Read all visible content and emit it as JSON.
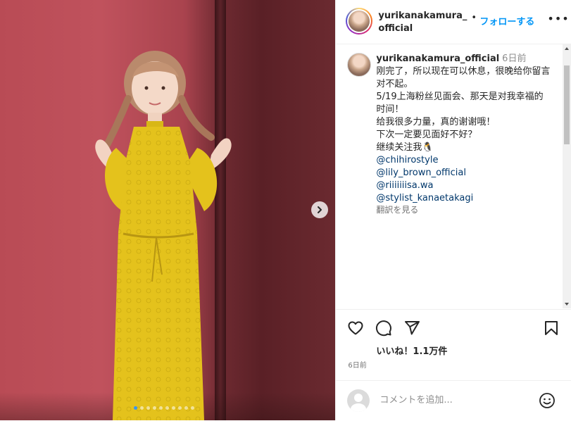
{
  "header": {
    "username": "yurikanakamura_official",
    "separator": "•",
    "follow_label": "フォローする",
    "more_label": "•••"
  },
  "caption": {
    "username": "yurikanakamura_official",
    "time": "6日前",
    "lines": [
      "刚完了，所以现在可以休息，很晚给你留言对不起。",
      "5/19上海粉丝见面会、那天是对我幸福的时间！",
      "给我很多力量，真的谢谢哦！",
      "下次一定要见面好不好？",
      "继续关注我🐧"
    ],
    "tags": [
      "@chihirostyle",
      "@lily_brown_official",
      "@riiiiiiisa.wa",
      "@stylist_kanaetakagi"
    ],
    "translate_label": "翻訳を見る"
  },
  "actions": {
    "likes": "いいね！1.1万件",
    "time_ago": "6日前"
  },
  "comment_box": {
    "placeholder": "コメントを追加..."
  },
  "carousel": {
    "slide_count": 10,
    "active_index": 0
  },
  "colors": {
    "follow": "#0095f6",
    "tag": "#00376b",
    "dress": "#e4c21c",
    "wall": "#b94b55"
  },
  "icons": {
    "like": "heart-icon",
    "comment": "comment-icon",
    "share": "share-icon",
    "save": "bookmark-icon",
    "emoji": "emoji-icon",
    "next": "chevron-right-icon"
  }
}
